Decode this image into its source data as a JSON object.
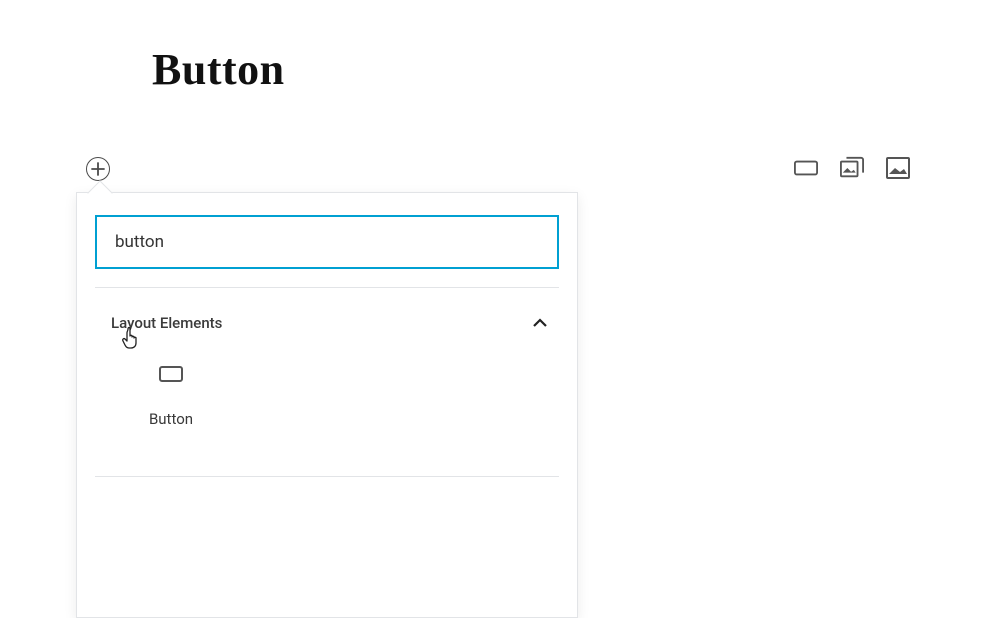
{
  "title": "Button",
  "search": {
    "value": "button",
    "placeholder": ""
  },
  "section": {
    "title": "Layout Elements",
    "expanded": true
  },
  "blocks": [
    {
      "label": "Button",
      "icon": "button-icon"
    }
  ],
  "toolbar_icons": {
    "button": "button",
    "gallery": "gallery",
    "image": "image"
  }
}
